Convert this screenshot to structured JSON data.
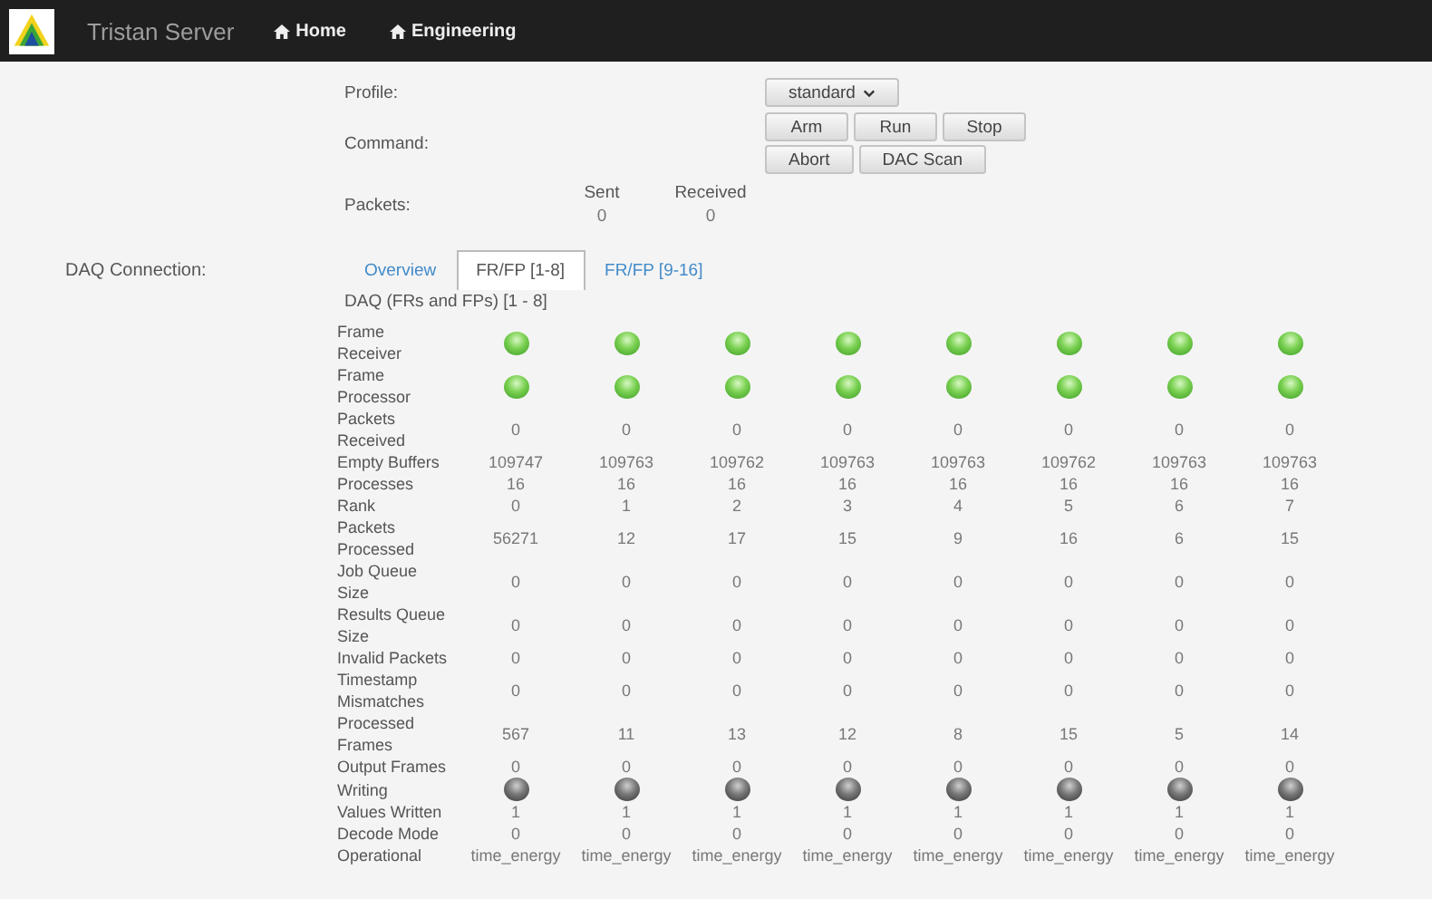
{
  "navbar": {
    "brand": "Tristan Server",
    "links": [
      {
        "label": "Home"
      },
      {
        "label": "Engineering"
      }
    ]
  },
  "form": {
    "profile_label": "Profile:",
    "profile_value": "standard",
    "command_label": "Command:",
    "command_rows": [
      [
        "Arm",
        "Run",
        "Stop"
      ],
      [
        "Abort",
        "DAC Scan"
      ]
    ],
    "packets_label": "Packets:",
    "packets": [
      {
        "heading": "Sent",
        "value": "0"
      },
      {
        "heading": "Received",
        "value": "0"
      }
    ]
  },
  "daq": {
    "label": "DAQ Connection:",
    "tabs": [
      {
        "label": "Overview",
        "selected": false
      },
      {
        "label": "FR/FP [1-8]",
        "selected": true
      },
      {
        "label": "FR/FP [9-16]",
        "selected": false
      }
    ],
    "heading": "DAQ (FRs and FPs) [1 - 8]",
    "rows": [
      {
        "label": "Frame Receiver",
        "kind": "led",
        "cells": [
          {
            "on": true
          },
          {
            "on": true
          },
          {
            "on": true
          },
          {
            "on": true
          },
          {
            "on": true
          },
          {
            "on": true
          },
          {
            "on": true
          },
          {
            "on": true
          }
        ]
      },
      {
        "label": "Frame Processor",
        "kind": "led",
        "cells": [
          {
            "on": true
          },
          {
            "on": true
          },
          {
            "on": true
          },
          {
            "on": true
          },
          {
            "on": true
          },
          {
            "on": true
          },
          {
            "on": true
          },
          {
            "on": true
          }
        ]
      },
      {
        "label": "Packets Received",
        "kind": "text",
        "cells": [
          "0",
          "0",
          "0",
          "0",
          "0",
          "0",
          "0",
          "0"
        ]
      },
      {
        "label": "Empty Buffers",
        "kind": "text",
        "cells": [
          "109747",
          "109763",
          "109762",
          "109763",
          "109763",
          "109762",
          "109763",
          "109763"
        ]
      },
      {
        "label": "Processes",
        "kind": "text",
        "cells": [
          "16",
          "16",
          "16",
          "16",
          "16",
          "16",
          "16",
          "16"
        ]
      },
      {
        "label": "Rank",
        "kind": "text",
        "cells": [
          "0",
          "1",
          "2",
          "3",
          "4",
          "5",
          "6",
          "7"
        ]
      },
      {
        "label": "Packets Processed",
        "kind": "text",
        "cells": [
          "56271",
          "12",
          "17",
          "15",
          "9",
          "16",
          "6",
          "15"
        ]
      },
      {
        "label": "Job Queue Size",
        "kind": "text",
        "cells": [
          "0",
          "0",
          "0",
          "0",
          "0",
          "0",
          "0",
          "0"
        ]
      },
      {
        "label": "Results Queue Size",
        "kind": "text",
        "cells": [
          "0",
          "0",
          "0",
          "0",
          "0",
          "0",
          "0",
          "0"
        ]
      },
      {
        "label": "Invalid Packets",
        "kind": "text",
        "cells": [
          "0",
          "0",
          "0",
          "0",
          "0",
          "0",
          "0",
          "0"
        ]
      },
      {
        "label": "Timestamp Mismatches",
        "kind": "text",
        "cells": [
          "0",
          "0",
          "0",
          "0",
          "0",
          "0",
          "0",
          "0"
        ]
      },
      {
        "label": "Processed Frames",
        "kind": "text",
        "cells": [
          "567",
          "11",
          "13",
          "12",
          "8",
          "15",
          "5",
          "14"
        ]
      },
      {
        "label": "Output Frames",
        "kind": "text",
        "cells": [
          "0",
          "0",
          "0",
          "0",
          "0",
          "0",
          "0",
          "0"
        ]
      },
      {
        "label": "Writing",
        "kind": "led",
        "cells": [
          {
            "on": false
          },
          {
            "on": false
          },
          {
            "on": false
          },
          {
            "on": false
          },
          {
            "on": false
          },
          {
            "on": false
          },
          {
            "on": false
          },
          {
            "on": false
          }
        ]
      },
      {
        "label": "Values Written",
        "kind": "text",
        "cells": [
          "1",
          "1",
          "1",
          "1",
          "1",
          "1",
          "1",
          "1"
        ]
      },
      {
        "label": "Decode Mode",
        "kind": "text",
        "cells": [
          "0",
          "0",
          "0",
          "0",
          "0",
          "0",
          "0",
          "0"
        ]
      },
      {
        "label": "Operational",
        "kind": "text",
        "cells": [
          "time_energy",
          "time_energy",
          "time_energy",
          "time_energy",
          "time_energy",
          "time_energy",
          "time_energy",
          "time_energy"
        ]
      }
    ]
  }
}
